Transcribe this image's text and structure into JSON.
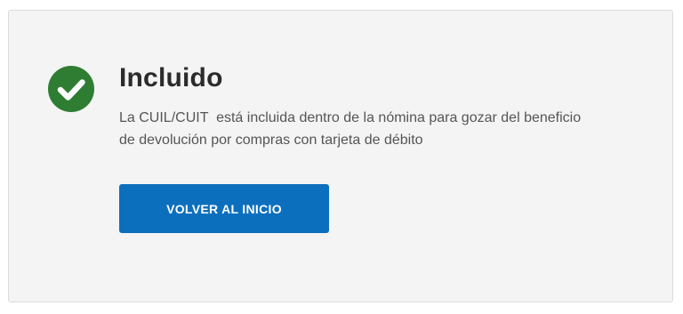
{
  "result": {
    "status_icon": "check-circle-icon",
    "status_color": "#2e7d32",
    "title": "Incluido",
    "message": "La CUIL/CUIT  está incluida dentro de la nómina para gozar del beneficio\nde devolución por compras con tarjeta de débito",
    "button_label": "VOLVER AL INICIO",
    "button_color": "#0b6fbd"
  }
}
